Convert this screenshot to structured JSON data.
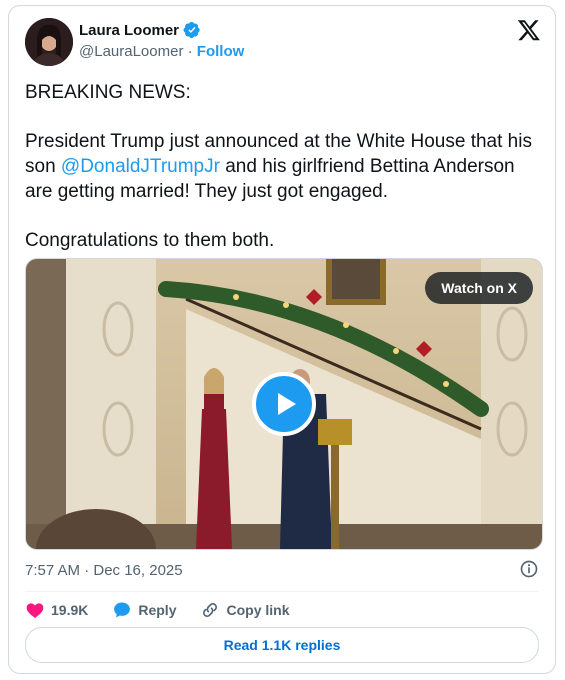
{
  "author": {
    "name": "Laura Loomer",
    "handle": "@LaurаLoomer",
    "follow_label": "Follow",
    "separator": "·"
  },
  "tweet": {
    "paragraph1": "BREAKING NEWS:",
    "paragraph2_before": "President Trump just announced at the White House that his son ",
    "mention": "@DonaldJTrumpJr",
    "paragraph2_after": " and his girlfriend Bettina Anderson are getting married! They just got engaged.",
    "paragraph3": "Congratulations to them both."
  },
  "media": {
    "watch_label": "Watch on X"
  },
  "meta": {
    "timestamp": "7:57 AM · Dec 16, 2025"
  },
  "actions": {
    "likes_count": "19.9K",
    "reply_label": "Reply",
    "copy_link_label": "Copy link",
    "read_replies_label": "Read 1.1K replies"
  },
  "colors": {
    "accent": "#1d9bf0",
    "like": "#f91880",
    "text": "#0f1419",
    "muted": "#536471"
  }
}
